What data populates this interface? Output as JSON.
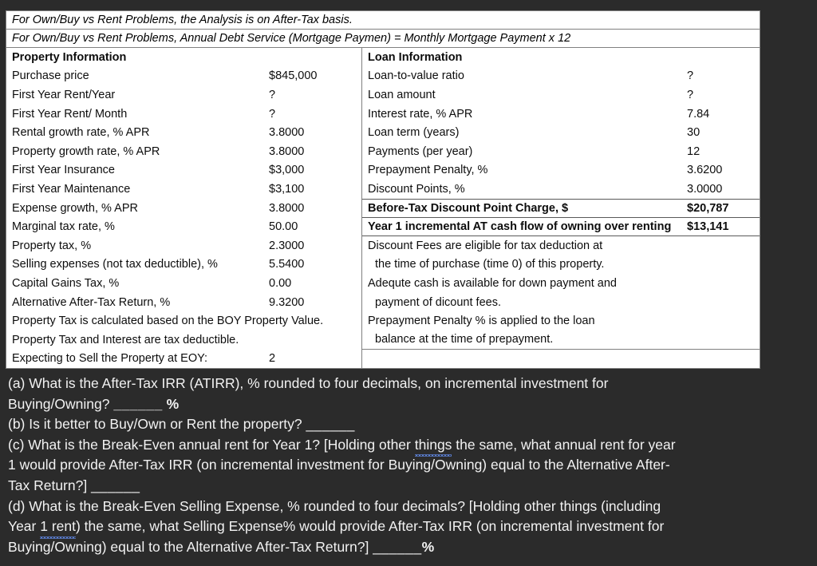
{
  "banners": [
    "For Own/Buy vs Rent Problems, the Analysis is on After-Tax basis.",
    "For Own/Buy vs Rent Problems, Annual Debt Service (Mortgage Paymen) = Monthly Mortgage Payment x 12"
  ],
  "property": {
    "heading": "Property Information",
    "rows": [
      {
        "label": "Purchase price",
        "value": "$845,000"
      },
      {
        "label": "First Year Rent/Year",
        "value": "?"
      },
      {
        "label": "First Year Rent/ Month",
        "value": "?"
      },
      {
        "label": "Rental growth rate, % APR",
        "value": "3.8000"
      },
      {
        "label": "Property growth rate, % APR",
        "value": "3.8000"
      },
      {
        "label": "First Year Insurance",
        "value": "$3,000"
      },
      {
        "label": "First Year Maintenance",
        "value": "$3,100"
      },
      {
        "label": "Expense growth, % APR",
        "value": "3.8000"
      },
      {
        "label": "Marginal tax rate, %",
        "value": "50.00"
      },
      {
        "label": "Property tax, %",
        "value": "2.3000"
      },
      {
        "label": "Selling expenses (not tax deductible), %",
        "value": "5.5400"
      },
      {
        "label": "Capital Gains Tax,  %",
        "value": "0.00"
      },
      {
        "label": "Alternative After-Tax Return, %",
        "value": "9.3200"
      }
    ],
    "notes": [
      "Property Tax is calculated based on the BOY Property Value.",
      "Property Tax and Interest are tax deductible."
    ],
    "eoy": {
      "label": "Expecting to Sell the Property at EOY:",
      "value": "2"
    }
  },
  "loan": {
    "heading": "Loan Information",
    "rows": [
      {
        "label": "Loan-to-value ratio",
        "value": "?"
      },
      {
        "label": "Loan amount",
        "value": "?"
      },
      {
        "label": "Interest rate, % APR",
        "value": "7.84"
      },
      {
        "label": "Loan term (years)",
        "value": "30"
      },
      {
        "label": "Payments (per year)",
        "value": "12"
      },
      {
        "label": "Prepayment Penalty, %",
        "value": "3.6200"
      },
      {
        "label": "Discount Points, %",
        "value": "3.0000"
      }
    ],
    "highlight_rows": [
      {
        "label": "Before-Tax Discount Point Charge, $",
        "value": "$20,787"
      },
      {
        "label": "Year 1 incremental AT cash flow of owning over renting",
        "value": "$13,141"
      }
    ],
    "assumptions": [
      {
        "text": "Discount Fees are eligible for tax deduction at",
        "indent": false
      },
      {
        "text": "the time of purchase (time 0) of this property.",
        "indent": true
      },
      {
        "text": "Adequte cash is available for down payment and",
        "indent": false
      },
      {
        "text": "payment of dicount fees.",
        "indent": true
      },
      {
        "text": "Prepayment Penalty % is applied to the loan",
        "indent": false
      },
      {
        "text": "balance at the time of prepayment.",
        "indent": true
      }
    ]
  },
  "questions": {
    "a": {
      "p1": "(a) What is the After-Tax IRR (ATIRR), % rounded to four decimals, on incremental investment for",
      "p2_before": "Buying/Owning? ",
      "p2_blank": "______",
      "p2_after": " %"
    },
    "b": {
      "before": "(b) Is it better to Buy/Own or Rent the property? ",
      "blank": "______"
    },
    "c": {
      "l1_a": "(c) What is the Break-Even annual rent for Year 1? [Holding other ",
      "l1_misspelled": "things",
      "l1_b": " the same, what annual rent for year",
      "l2": "1 would provide After-Tax IRR (on incremental investment for Buying/Owning) equal to the Alternative After-",
      "l3_before": "Tax Return?] ",
      "l3_blank": "______"
    },
    "d": {
      "l1": "(d) What is the Break-Even Selling Expense, % rounded to four decimals? [Holding other things (including",
      "l2_a": "Year ",
      "l2_misspelled": "1  rent",
      "l2_b": ") the same, what Selling Expense% would provide After-Tax IRR (on incremental investment for",
      "l3_before": "Buying/Owning) equal to the Alternative After-Tax Return?] ",
      "l3_blank": "______",
      "l3_after": "%"
    }
  },
  "colors": {
    "page_background": "#2b2b2b",
    "sheet_background": "#ffffff",
    "gridline": "#808080",
    "question_text": "#f2f2f2",
    "spellcheck_underline": "#5b7fd4"
  }
}
